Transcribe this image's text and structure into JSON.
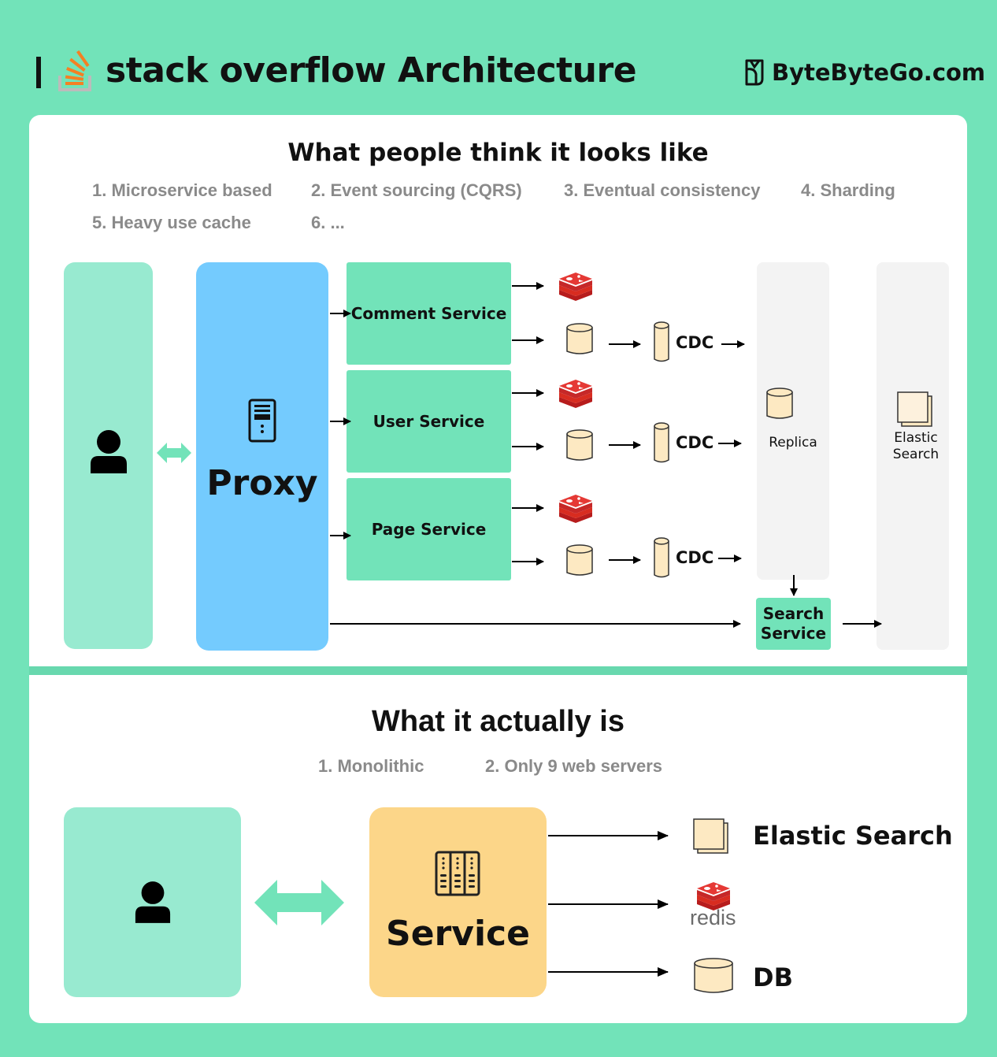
{
  "header": {
    "title": "stack overflow Architecture",
    "brand": "ByteByteGo.com",
    "logo_icon": "stackoverflow-logo-icon",
    "brand_icon": "bytebytego-logo-icon"
  },
  "colors": {
    "background": "#72e3b9",
    "service_green": "#72e3b9",
    "user_panel": "#98ead0",
    "proxy_blue": "#74cbfe",
    "service_yellow": "#fcd689",
    "db_fill": "#fde9c2",
    "redis_red": "#d82c20",
    "gray_column": "#f3f3f3"
  },
  "section1": {
    "heading": "What people think it looks like",
    "items": [
      "1. Microservice based",
      "2. Event sourcing (CQRS)",
      "3. Eventual consistency",
      "4. Sharding",
      "5. Heavy use cache",
      "6. ..."
    ],
    "user_icon": "user-icon",
    "proxy": {
      "label": "Proxy",
      "icon": "server-icon"
    },
    "services": [
      {
        "label": "Comment Service",
        "cache": "redis",
        "db": "database",
        "cdc": "CDC"
      },
      {
        "label": "User Service",
        "cache": "redis",
        "db": "database",
        "cdc": "CDC"
      },
      {
        "label": "Page Service",
        "cache": "redis",
        "db": "database",
        "cdc": "CDC"
      }
    ],
    "replica": "Replica",
    "elastic_search": "Elastic\nSearch",
    "elastic_line1": "Elastic",
    "elastic_line2": "Search",
    "search_service_line1": "Search",
    "search_service_line2": "Service"
  },
  "section2": {
    "heading": "What it actually is",
    "items": [
      "1.  Monolithic",
      "2. Only 9 web servers"
    ],
    "service": {
      "label": "Service",
      "icon": "server-rack-icon"
    },
    "targets": [
      {
        "label": "Elastic Search",
        "icon": "elastic-search-icon"
      },
      {
        "label": "redis",
        "icon": "redis-icon"
      },
      {
        "label": "DB",
        "icon": "database-icon"
      }
    ]
  }
}
